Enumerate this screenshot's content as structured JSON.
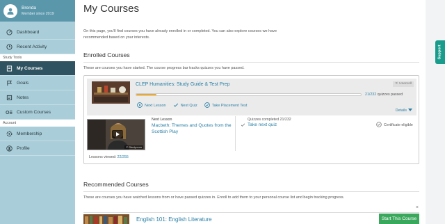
{
  "user": {
    "name": "Brenda",
    "member_since": "Member since 2019"
  },
  "sidebar": {
    "items_main": [
      {
        "label": "Dashboard",
        "icon": "dashboard-icon"
      },
      {
        "label": "Recent Activity",
        "icon": "clock-icon"
      }
    ],
    "study_tools_heading": "Study Tools",
    "items_tools": [
      {
        "label": "My Courses",
        "icon": "book-icon",
        "active": true
      },
      {
        "label": "Goals",
        "icon": "flag-icon"
      },
      {
        "label": "Notes",
        "icon": "note-icon"
      },
      {
        "label": "Custom Courses",
        "icon": "custom-courses-icon"
      }
    ],
    "account_heading": "Account",
    "items_account": [
      {
        "label": "Membership",
        "icon": "gear-icon"
      },
      {
        "label": "Profile",
        "icon": "person-icon"
      }
    ]
  },
  "page": {
    "title": "My Courses",
    "intro": "On this page, you'll find courses you have already enrolled in or completed. You can also explore courses we have recommended based on your interests."
  },
  "enrolled": {
    "heading": "Enrolled Courses",
    "description": "These are courses you have started. The course progress bar tracks quizzes you have passed.",
    "course": {
      "title": "CLEP Humanities: Study Guide & Test Prep",
      "unenroll_label": "Unenroll",
      "progress_fraction": 0.091,
      "quizzes_done": "21/232",
      "quizzes_passed_label": "quizzes passed",
      "actions": [
        {
          "label": "Next Lesson",
          "icon": "play-circle-icon"
        },
        {
          "label": "Next Quiz",
          "icon": "quiz-icon"
        },
        {
          "label": "Take Placement Test",
          "icon": "placement-test-icon"
        }
      ],
      "details_label": "Details",
      "next_lesson_label": "Next Lesson",
      "next_lesson_title": "Macbeth: Themes and Quotes from the Scottish Play",
      "video_logo": "© Study.com",
      "quizzes_completed_label": "Quizzes completed 21/232",
      "take_next_quiz": "Take next quiz",
      "certificate_label": "Certificate eligible",
      "lessons_viewed_label": "Lessons viewed:",
      "lessons_viewed_value": "22/255"
    }
  },
  "recommended": {
    "heading": "Recommended Courses",
    "description": "These are courses you have watched lessons from or have passed quizzes in. Enroll to add them to your personal course list and begin tracking progress.",
    "close_label": "×",
    "course": {
      "title": "English 101: English Literature",
      "button": "Start This Course"
    }
  },
  "support_label": "Support",
  "colors": {
    "sidebar": "#a9cdd9",
    "active": "#2f5360",
    "link": "#2a7fa5",
    "progress": "#f3a81b",
    "start_button": "#3aa85c",
    "support": "#199c8b"
  }
}
